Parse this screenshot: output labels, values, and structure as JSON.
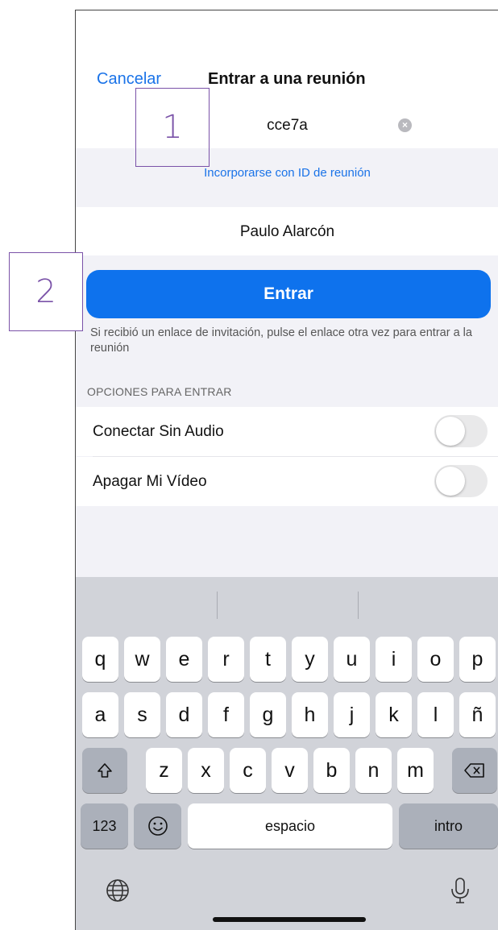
{
  "nav": {
    "cancel_label": "Cancelar",
    "title": "Entrar a una reunión"
  },
  "meeting_field": {
    "value": "cce7a",
    "clear_icon": "clear-circle-icon"
  },
  "join_with_id_link": "Incorporarse con ID de reunión",
  "name_field": {
    "value": "Paulo Alarcón"
  },
  "join_button": {
    "label": "Entrar",
    "color": "#0e72ed"
  },
  "hint_text": "Si recibió un enlace de invitación, pulse el enlace otra vez para entrar a la reunión",
  "options": {
    "header": "OPCIONES PARA ENTRAR",
    "items": [
      {
        "label": "Conectar Sin Audio",
        "enabled": false
      },
      {
        "label": "Apagar Mi Vídeo",
        "enabled": false
      }
    ]
  },
  "keyboard": {
    "row1": [
      "q",
      "w",
      "e",
      "r",
      "t",
      "y",
      "u",
      "i",
      "o",
      "p"
    ],
    "row2": [
      "a",
      "s",
      "d",
      "f",
      "g",
      "h",
      "j",
      "k",
      "l",
      "ñ"
    ],
    "row3": [
      "z",
      "x",
      "c",
      "v",
      "b",
      "n",
      "m"
    ],
    "numbers_label": "123",
    "space_label": "espacio",
    "return_label": "intro",
    "icons": [
      "shift-icon",
      "backspace-icon",
      "emoji-icon",
      "globe-icon",
      "microphone-icon"
    ]
  },
  "annotations": {
    "callout_1": "1",
    "callout_2": "2",
    "color": "#7a52a8"
  }
}
